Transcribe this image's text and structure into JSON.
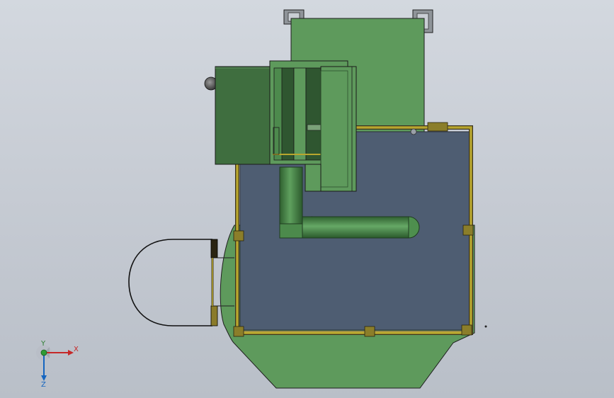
{
  "triad": {
    "x_label": "X",
    "y_label": "Y",
    "z_label": "Z"
  },
  "colors": {
    "background_top": "#d3d8df",
    "background_bottom": "#b9bfc8",
    "body_green": "#5e9a5c",
    "dark_green": "#3f6e3f",
    "pipe_green": "#3d7c3e",
    "rail_yellow": "#b8a62e",
    "floor_slate": "#4e5d72",
    "grey_block": "#5f6166"
  }
}
